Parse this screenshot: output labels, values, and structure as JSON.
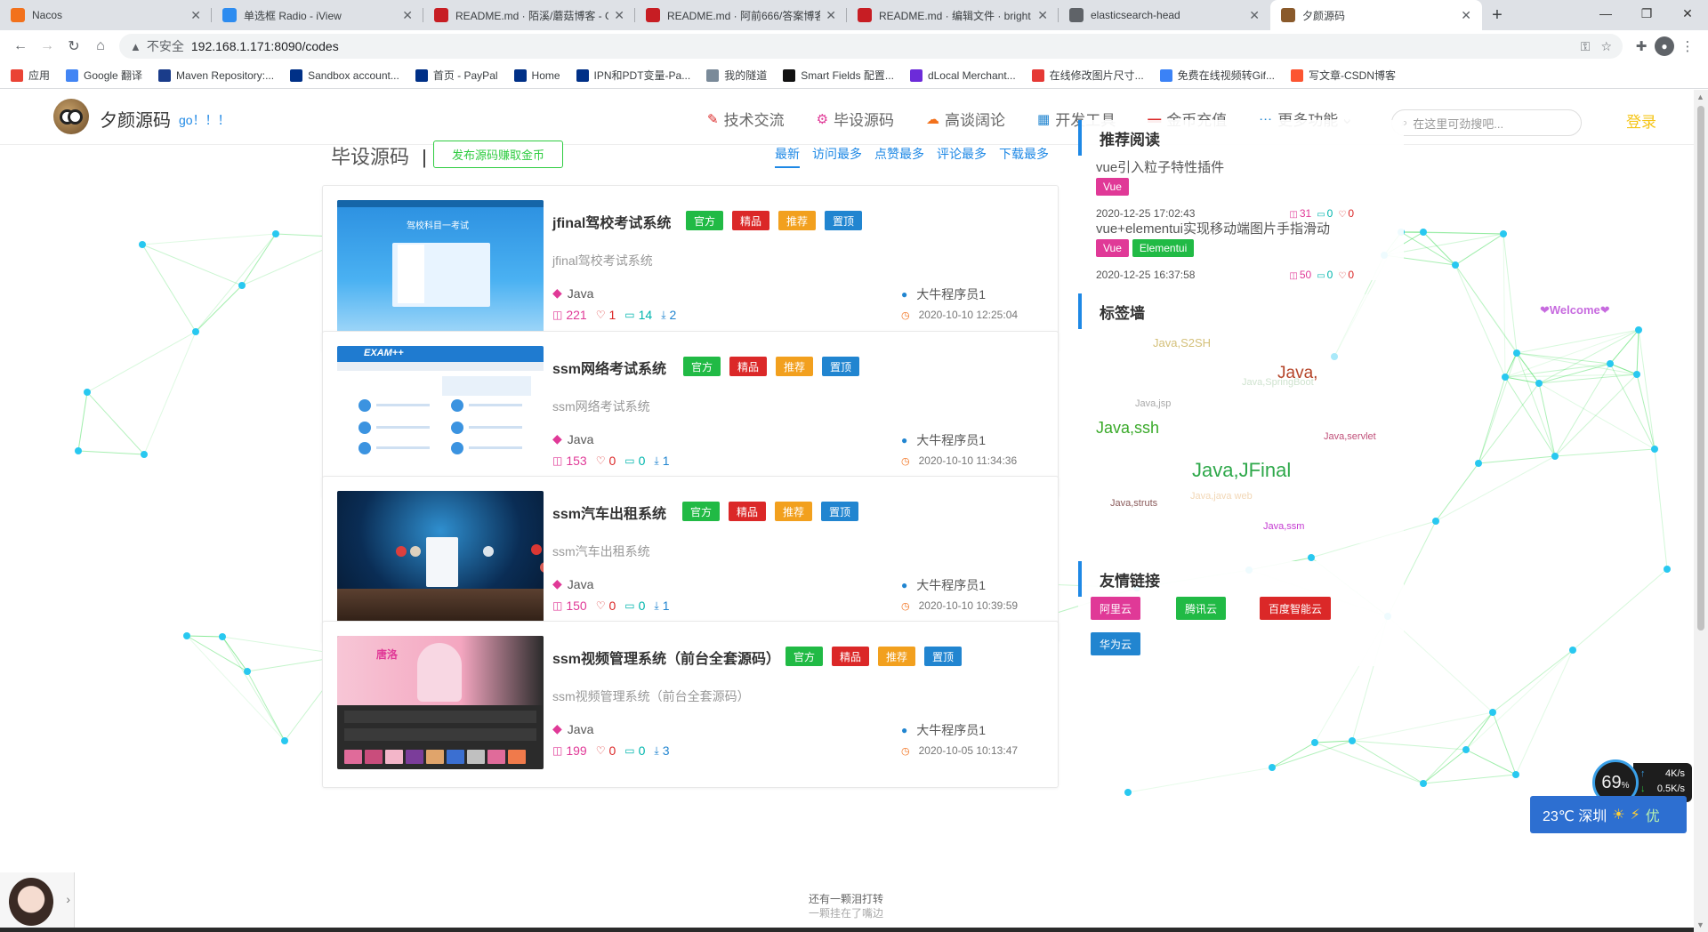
{
  "browser": {
    "tabs": [
      {
        "title": "Nacos",
        "color": "#f2711c"
      },
      {
        "title": "单选框 Radio - iView",
        "color": "#2d8cf0"
      },
      {
        "title": "README.md · 陌溪/蘑菇博客 - G",
        "color": "#c71d23"
      },
      {
        "title": "README.md · 阿前666/答案博客",
        "color": "#c71d23"
      },
      {
        "title": "README.md · 编辑文件 · bright",
        "color": "#c71d23"
      },
      {
        "title": "elasticsearch-head",
        "color": "#5f6368"
      },
      {
        "title": "夕颜源码",
        "color": "#8a5a2b"
      }
    ],
    "active_tab": 6,
    "insecure_label": "不安全",
    "url": "192.168.1.171:8090/codes",
    "bookmarks": [
      {
        "label": "应用",
        "color": "#ea4335"
      },
      {
        "label": "Google 翻译",
        "color": "#4285f4"
      },
      {
        "label": "Maven Repository:...",
        "color": "#1a3c8a"
      },
      {
        "label": "Sandbox account...",
        "color": "#003087"
      },
      {
        "label": "首页 - PayPal",
        "color": "#003087"
      },
      {
        "label": "Home",
        "color": "#003087"
      },
      {
        "label": "IPN和PDT变量-Pa...",
        "color": "#003087"
      },
      {
        "label": "我的隧道",
        "color": "#7a8a99"
      },
      {
        "label": "Smart Fields 配置...",
        "color": "#111111"
      },
      {
        "label": "dLocal Merchant...",
        "color": "#6c2bd9"
      },
      {
        "label": "在线修改图片尺寸...",
        "color": "#e53935"
      },
      {
        "label": "免费在线视频转Gif...",
        "color": "#3b82f6"
      },
      {
        "label": "写文章-CSDN博客",
        "color": "#fc5531"
      }
    ]
  },
  "site": {
    "title": "夕颜源码",
    "slogan": "go！！！",
    "nav": [
      {
        "label": "技术交流",
        "icon": "feather-icon",
        "glyph": "✎",
        "color": "#db2828"
      },
      {
        "label": "毕设源码",
        "icon": "share-icon",
        "glyph": "⚙",
        "color": "#e03997"
      },
      {
        "label": "高谈阔论",
        "icon": "cloud-icon",
        "glyph": "☁",
        "color": "#f2711c"
      },
      {
        "label": "开发工具",
        "icon": "calendar-icon",
        "glyph": "▦",
        "color": "#2185d0"
      },
      {
        "label": "金币充值",
        "icon": "wallet-icon",
        "glyph": "▬",
        "color": "#db2828"
      },
      {
        "label": "更多功能",
        "icon": "more-icon",
        "glyph": "⋯",
        "color": "#2185d0"
      }
    ],
    "search_placeholder": "在这里可劲搜吧...",
    "login_label": "登录"
  },
  "main": {
    "section_title": "毕设源码",
    "publish_label": "发布源码赚取金币",
    "sorts": [
      "最新",
      "访问最多",
      "点赞最多",
      "评论最多",
      "下载最多"
    ],
    "badges": [
      "官方",
      "精品",
      "推荐",
      "置顶"
    ],
    "cards": [
      {
        "title": "jfinal驾校考试系统",
        "desc": "jfinal驾校考试系统",
        "lang": "Java",
        "views": "221",
        "likes": "1",
        "comments": "14",
        "downloads": "2",
        "author": "大牛程序员1",
        "date": "2020-10-10 12:25:04",
        "thumb_caption": "驾校科目一考试"
      },
      {
        "title": "ssm网络考试系统",
        "desc": "ssm网络考试系统",
        "lang": "Java",
        "views": "153",
        "likes": "0",
        "comments": "0",
        "downloads": "1",
        "author": "大牛程序员1",
        "date": "2020-10-10 11:34:36",
        "thumb_caption": "EXAM++"
      },
      {
        "title": "ssm汽车出租系统",
        "desc": "ssm汽车出租系统",
        "lang": "Java",
        "views": "150",
        "likes": "0",
        "comments": "0",
        "downloads": "1",
        "author": "大牛程序员1",
        "date": "2020-10-10 10:39:59",
        "thumb_caption": ""
      },
      {
        "title": "ssm视频管理系统（前台全套源码）",
        "desc": "ssm视频管理系统（前台全套源码）",
        "lang": "Java",
        "views": "199",
        "likes": "0",
        "comments": "0",
        "downloads": "3",
        "author": "大牛程序员1",
        "date": "2020-10-05 10:13:47",
        "thumb_caption": "唐洛"
      }
    ]
  },
  "sidebar": {
    "recommend_title": "推荐阅读",
    "recommend": [
      {
        "title": "vue引入粒子特性插件",
        "tags": [
          "Vue"
        ],
        "date": "2020-12-25 17:02:43",
        "views": "31",
        "comments": "0",
        "likes": "0"
      },
      {
        "title": "vue+elementui实现移动端图片手指滑动",
        "tags": [
          "Vue",
          "Elementui"
        ],
        "date": "2020-12-25 16:37:58",
        "views": "50",
        "comments": "0",
        "likes": "0"
      }
    ],
    "tagwall_title": "标签墙",
    "tag_cloud": [
      {
        "text": "Java,S2SH",
        "color": "#d4c07a"
      },
      {
        "text": "Java,",
        "color": "#b5452a"
      },
      {
        "text": "Java,SpringBoot",
        "color": "#cfe3cf"
      },
      {
        "text": "Java,jsp",
        "color": "#a9a9a9"
      },
      {
        "text": "Java,ssh",
        "color": "#3aaa2a"
      },
      {
        "text": "Java,servlet",
        "color": "#c0507a"
      },
      {
        "text": "Java,JFinal",
        "color": "#2ea84a"
      },
      {
        "text": "Java,java web",
        "color": "#f2d7b6"
      },
      {
        "text": "Java,struts",
        "color": "#8a5a5a"
      },
      {
        "text": "Java,ssm",
        "color": "#c43ad1"
      }
    ],
    "welcome": "❤Welcome❤",
    "links_title": "友情链接",
    "links": [
      {
        "label": "阿里云",
        "color": "#e03997"
      },
      {
        "label": "腾讯云",
        "color": "#21ba45"
      },
      {
        "label": "百度智能云",
        "color": "#db2828"
      },
      {
        "label": "华为云",
        "color": "#2185d0"
      }
    ]
  },
  "widgets": {
    "quip_line1": "还有一颗泪打转",
    "quip_line2": "一颗挂在了嘴边",
    "cpu_percent": "69",
    "upload_rate": "4K/s",
    "download_rate": "0.5K/s",
    "weather": "23℃ 深圳",
    "air_quality": "优"
  }
}
